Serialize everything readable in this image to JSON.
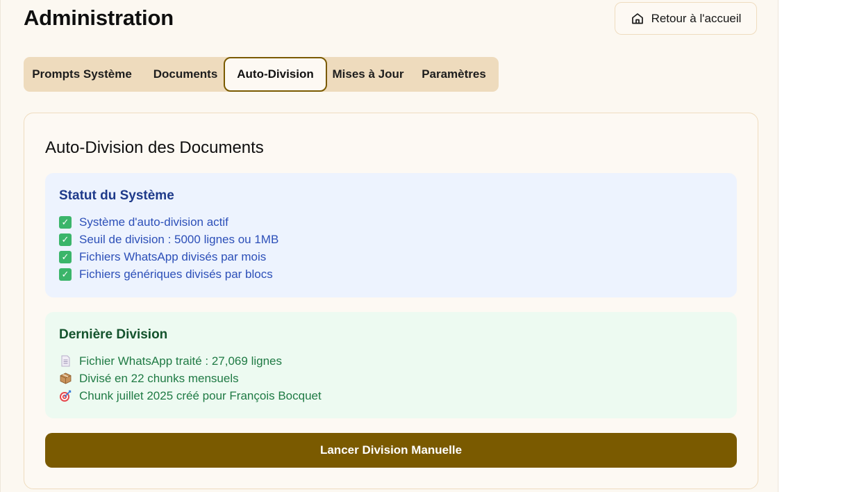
{
  "header": {
    "title": "Administration",
    "home_button": "Retour à l'accueil"
  },
  "tabs": [
    {
      "label": "Prompts Système",
      "active": false
    },
    {
      "label": "Documents",
      "active": false
    },
    {
      "label": "Auto-Division",
      "active": true
    },
    {
      "label": "Mises à Jour",
      "active": false
    },
    {
      "label": "Paramètres",
      "active": false
    }
  ],
  "card": {
    "title": "Auto-Division des Documents",
    "status": {
      "title": "Statut du Système",
      "items": [
        {
          "icon": "check-mark-icon",
          "text": "Système d'auto-division actif"
        },
        {
          "icon": "check-mark-icon",
          "text": "Seuil de division : 5000 lignes ou 1MB"
        },
        {
          "icon": "check-mark-icon",
          "text": "Fichiers WhatsApp divisés par mois"
        },
        {
          "icon": "check-mark-icon",
          "text": "Fichiers génériques divisés par blocs"
        }
      ]
    },
    "last_division": {
      "title": "Dernière Division",
      "items": [
        {
          "icon": "document-icon",
          "text": "Fichier WhatsApp traité : 27,069 lignes"
        },
        {
          "icon": "package-icon",
          "text": "Divisé en 22 chunks mensuels"
        },
        {
          "icon": "target-icon",
          "text": "Chunk juillet 2025 créé pour François Bocquet"
        }
      ]
    },
    "action_button": "Lancer Division Manuelle"
  },
  "colors": {
    "accent": "#7a5a00",
    "tab_bar": "#eedbbd",
    "page_background": "#fcf8f1",
    "status_panel": "#edf3fe",
    "last_division_panel": "#edfaf1"
  }
}
